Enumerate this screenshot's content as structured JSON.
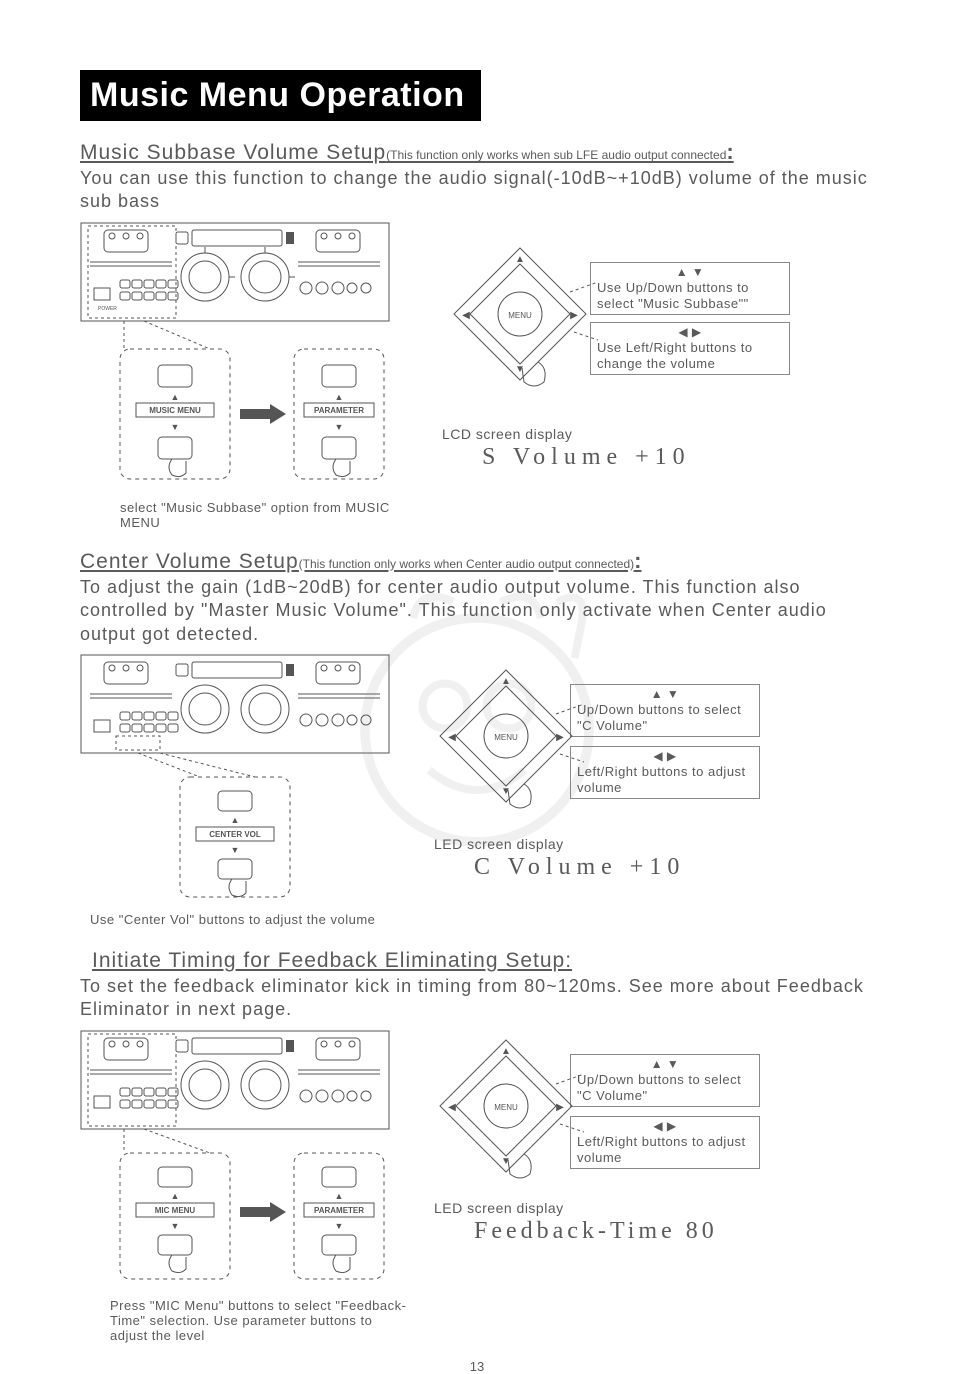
{
  "page": {
    "title": "Music Menu Operation",
    "number": "13"
  },
  "sections": [
    {
      "heading": "Music Subbase Volume Setup",
      "note": "(This function only works when sub LFE  audio  output  connected",
      "colon": ":",
      "body": "You can use this function to change the audio signal(-10dB~+10dB) volume of the music sub bass",
      "flow_left_label": "MUSIC MENU",
      "flow_right_label": "PARAMETER",
      "caption": "select  \"Music Subbase\" option from MUSIC MENU",
      "instr_up_icons": "▲  ▼",
      "instr_up": "Use Up/Down buttons to select \"Music Subbase\"\"",
      "instr_lr_icons": "◀  ▶",
      "instr_lr": "Use Left/Right buttons to change the volume",
      "lcd_label": "LCD screen display",
      "lcd_value": "S  Volume     +10"
    },
    {
      "heading": "Center Volume Setup",
      "note": "(This function only works when Center audio output  connected)",
      "colon": ":",
      "body": "To adjust the gain (1dB~20dB) for center audio output volume. This function also controlled by \"Master Music Volume\". This function only activate when Center audio output got detected.",
      "flow_center_label": "CENTER VOL",
      "caption": "Use \"Center Vol\" buttons to adjust the volume",
      "instr_up_icons": "▲  ▼",
      "instr_up": "Up/Down buttons to select \"C Volume\"",
      "instr_lr_icons": "◀  ▶",
      "instr_lr": "Left/Right buttons to adjust volume",
      "lcd_label": "LED screen display",
      "lcd_value": "C   Volume     +10"
    },
    {
      "heading": "Initiate Timing for Feedback Eliminating Setup:",
      "body": "To set the feedback eliminator kick in timing from 80~120ms. See more about  Feedback Eliminator in next page.",
      "flow_left_label": "MIC MENU",
      "flow_right_label": "PARAMETER",
      "caption": "Press \"MIC Menu\" buttons to select \"Feedback-Time\" selection. Use parameter buttons to adjust the level",
      "instr_up_icons": "▲  ▼",
      "instr_up": "Up/Down buttons to select \"C Volume\"",
      "instr_lr_icons": "◀  ▶",
      "instr_lr": "Left/Right buttons to adjust volume",
      "lcd_label": "LED screen display",
      "lcd_value": "Feedback-Time    80"
    }
  ]
}
